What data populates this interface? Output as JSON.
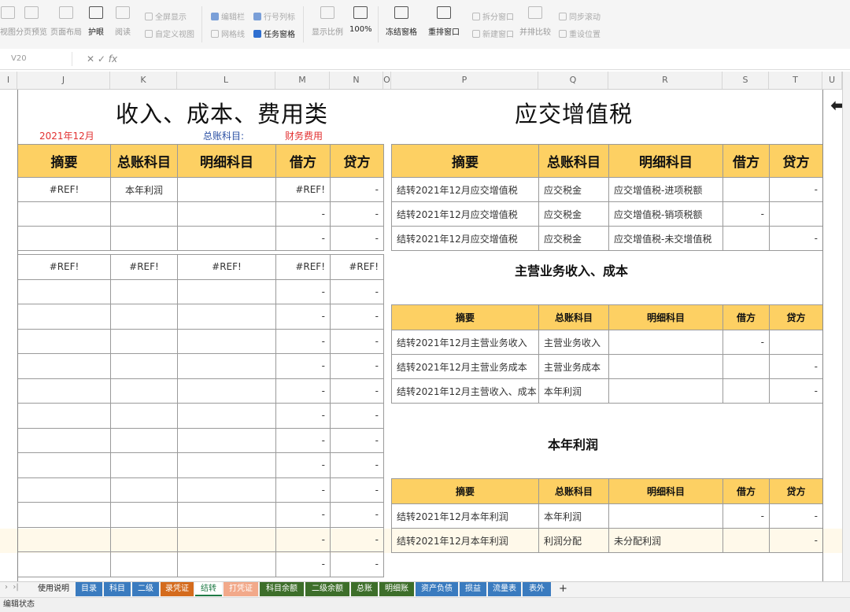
{
  "ribbon": {
    "items": [
      {
        "label": "视图",
        "dark": false
      },
      {
        "label": "分页预览",
        "dark": false
      },
      {
        "label": "页面布局",
        "dark": false
      },
      {
        "label": "护眼",
        "dark": true
      },
      {
        "label": "阅读",
        "dark": false
      },
      {
        "label": "显示比例",
        "dark": false
      },
      {
        "label": "100%",
        "dark": true
      },
      {
        "label": "冻结窗格",
        "dark": true
      },
      {
        "label": "重排窗口",
        "dark": true
      },
      {
        "label": "并排比较",
        "dark": false
      }
    ],
    "fullscreen": "全屏显示",
    "custom_view": "自定义视图",
    "edit_bar": "编辑栏",
    "gridlines": "网格线",
    "row_col_headers": "行号列标",
    "task_pane": "任务窗格",
    "split_window": "拆分窗口",
    "new_window": "新建窗口",
    "sync_scroll": "同步滚动",
    "reset_position": "重设位置"
  },
  "formula_bar": {
    "name_box": "V20",
    "fx": "fx"
  },
  "columns": [
    "I",
    "J",
    "K",
    "L",
    "M",
    "N",
    "O",
    "P",
    "Q",
    "R",
    "S",
    "T",
    "U"
  ],
  "left": {
    "title": "收入、成本、费用类",
    "date": "2021年12月",
    "account_label": "总账科目:",
    "account_value": "财务费用",
    "headers": [
      "摘要",
      "总账科目",
      "明细科目",
      "借方",
      "贷方"
    ],
    "rows1": [
      [
        "#REF!",
        "本年利润",
        "",
        "#REF!",
        "-"
      ],
      [
        "",
        "",
        "",
        "-",
        "-"
      ],
      [
        "",
        "",
        "",
        "-",
        "-"
      ]
    ],
    "rows2": [
      [
        "#REF!",
        "#REF!",
        "#REF!",
        "#REF!",
        "#REF!"
      ],
      [
        "",
        "",
        "",
        "-",
        "-"
      ],
      [
        "",
        "",
        "",
        "-",
        "-"
      ],
      [
        "",
        "",
        "",
        "-",
        "-"
      ],
      [
        "",
        "",
        "",
        "-",
        "-"
      ],
      [
        "",
        "",
        "",
        "-",
        "-"
      ],
      [
        "",
        "",
        "",
        "-",
        "-"
      ],
      [
        "",
        "",
        "",
        "-",
        "-"
      ],
      [
        "",
        "",
        "",
        "-",
        "-"
      ],
      [
        "",
        "",
        "",
        "-",
        "-"
      ],
      [
        "",
        "",
        "",
        "-",
        "-"
      ],
      [
        "",
        "",
        "",
        "-",
        "-"
      ],
      [
        "",
        "",
        "",
        "-",
        "-"
      ]
    ]
  },
  "right": {
    "title": "应交增值税",
    "headers": [
      "摘要",
      "总账科目",
      "明细科目",
      "借方",
      "贷方"
    ],
    "vat_rows": [
      [
        "结转2021年12月应交增值税",
        "应交税金",
        "应交增值税-进项税额",
        "",
        "-"
      ],
      [
        "结转2021年12月应交增值税",
        "应交税金",
        "应交增值税-销项税额",
        "-",
        ""
      ],
      [
        "结转2021年12月应交增值税",
        "应交税金",
        "应交增值税-未交增值税",
        "",
        "-"
      ]
    ],
    "main_title": "主营业务收入、成本",
    "main_rows": [
      [
        "结转2021年12月主营业务收入",
        "主营业务收入",
        "",
        "-",
        ""
      ],
      [
        "结转2021年12月主营业务成本",
        "主营业务成本",
        "",
        "",
        "-"
      ],
      [
        "结转2021年12月主营收入、成本",
        "本年利润",
        "",
        "",
        "-"
      ]
    ],
    "profit_title": "本年利润",
    "profit_rows": [
      [
        "结转2021年12月本年利润",
        "本年利润",
        "",
        "-",
        "-"
      ],
      [
        "结转2021年12月本年利润",
        "利润分配",
        "未分配利润",
        "",
        "-"
      ]
    ]
  },
  "tabs": [
    {
      "label": "使用说明",
      "color": "#f3f3f3",
      "text": "#222"
    },
    {
      "label": "目录",
      "color": "#3a7bbf",
      "text": "#fff"
    },
    {
      "label": "科目",
      "color": "#3a7bbf",
      "text": "#fff"
    },
    {
      "label": "二级",
      "color": "#3a7bbf",
      "text": "#fff"
    },
    {
      "label": "录凭证",
      "color": "#d46b1d",
      "text": "#fff"
    },
    {
      "label": "结转",
      "color": "#ffffff",
      "text": "#1f7a45"
    },
    {
      "label": "打凭证",
      "color": "#f2a98a",
      "text": "#fff"
    },
    {
      "label": "科目余额",
      "color": "#3d6e2a",
      "text": "#fff"
    },
    {
      "label": "二级余额",
      "color": "#3d6e2a",
      "text": "#fff"
    },
    {
      "label": "总账",
      "color": "#3d6e2a",
      "text": "#fff"
    },
    {
      "label": "明细账",
      "color": "#3d6e2a",
      "text": "#fff"
    },
    {
      "label": "资产负债",
      "color": "#3a7bbf",
      "text": "#fff"
    },
    {
      "label": "损益",
      "color": "#3a7bbf",
      "text": "#fff"
    },
    {
      "label": "流量表",
      "color": "#3a7bbf",
      "text": "#fff"
    },
    {
      "label": "表外",
      "color": "#3a7bbf",
      "text": "#fff"
    }
  ],
  "add_sheet": "+",
  "status": {
    "label": "编辑状态"
  }
}
